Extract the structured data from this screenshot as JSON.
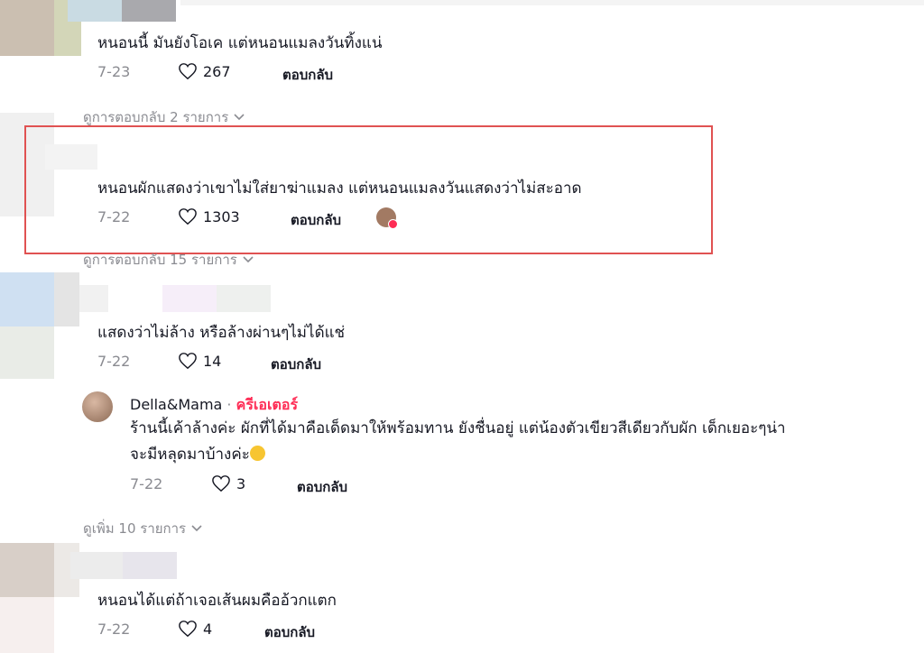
{
  "comments": [
    {
      "text": "หนอนนี้ มันยังโอเค แต่หนอนแมลงวันทิ้งแน่",
      "date": "7-23",
      "likes": "267",
      "reply": "ตอบกลับ"
    },
    {
      "text": "หนอนผักแสดงว่าเขาไม่ใส่ยาฆ่าแมลง แต่หนอนแมลงวันแสดงว่าไม่สะอาด",
      "date": "7-22",
      "likes": "1303",
      "reply": "ตอบกลับ"
    },
    {
      "text": "แสดงว่าไม่ล้าง หรือล้างผ่านๆไม่ได้แช่",
      "date": "7-22",
      "likes": "14",
      "reply": "ตอบกลับ"
    },
    {
      "text": "หนอนได้แต่ถ้าเจอเส้นผมคืออ้วกแตก",
      "date": "7-22",
      "likes": "4",
      "reply": "ตอบกลับ"
    }
  ],
  "view_replies": [
    {
      "label": "ดูการตอบกลับ 2 รายการ"
    },
    {
      "label": "ดูการตอบกลับ 15 รายการ"
    },
    {
      "label": "ดูเพิ่ม 10 รายการ"
    }
  ],
  "creator_reply": {
    "author": "Della&Mama",
    "separator": " · ",
    "role": "ครีเอเตอร์",
    "line1": "ร้านนี้เค้าล้างค่ะ ผักที่ได้มาคือเด็ดมาให้พร้อมทาน ยังชื่นอยู่ แต่น้องตัวเขียวสีเดียวกับผัก เด็กเยอะๆน่า",
    "line2": "จะมีหลุดมาบ้างค่ะ",
    "date": "7-22",
    "likes": "3",
    "reply": "ตอบกลับ"
  },
  "colors": {
    "accent": "#fe2c55",
    "highlight_border": "#e05252",
    "meta": "#8a8b91"
  }
}
